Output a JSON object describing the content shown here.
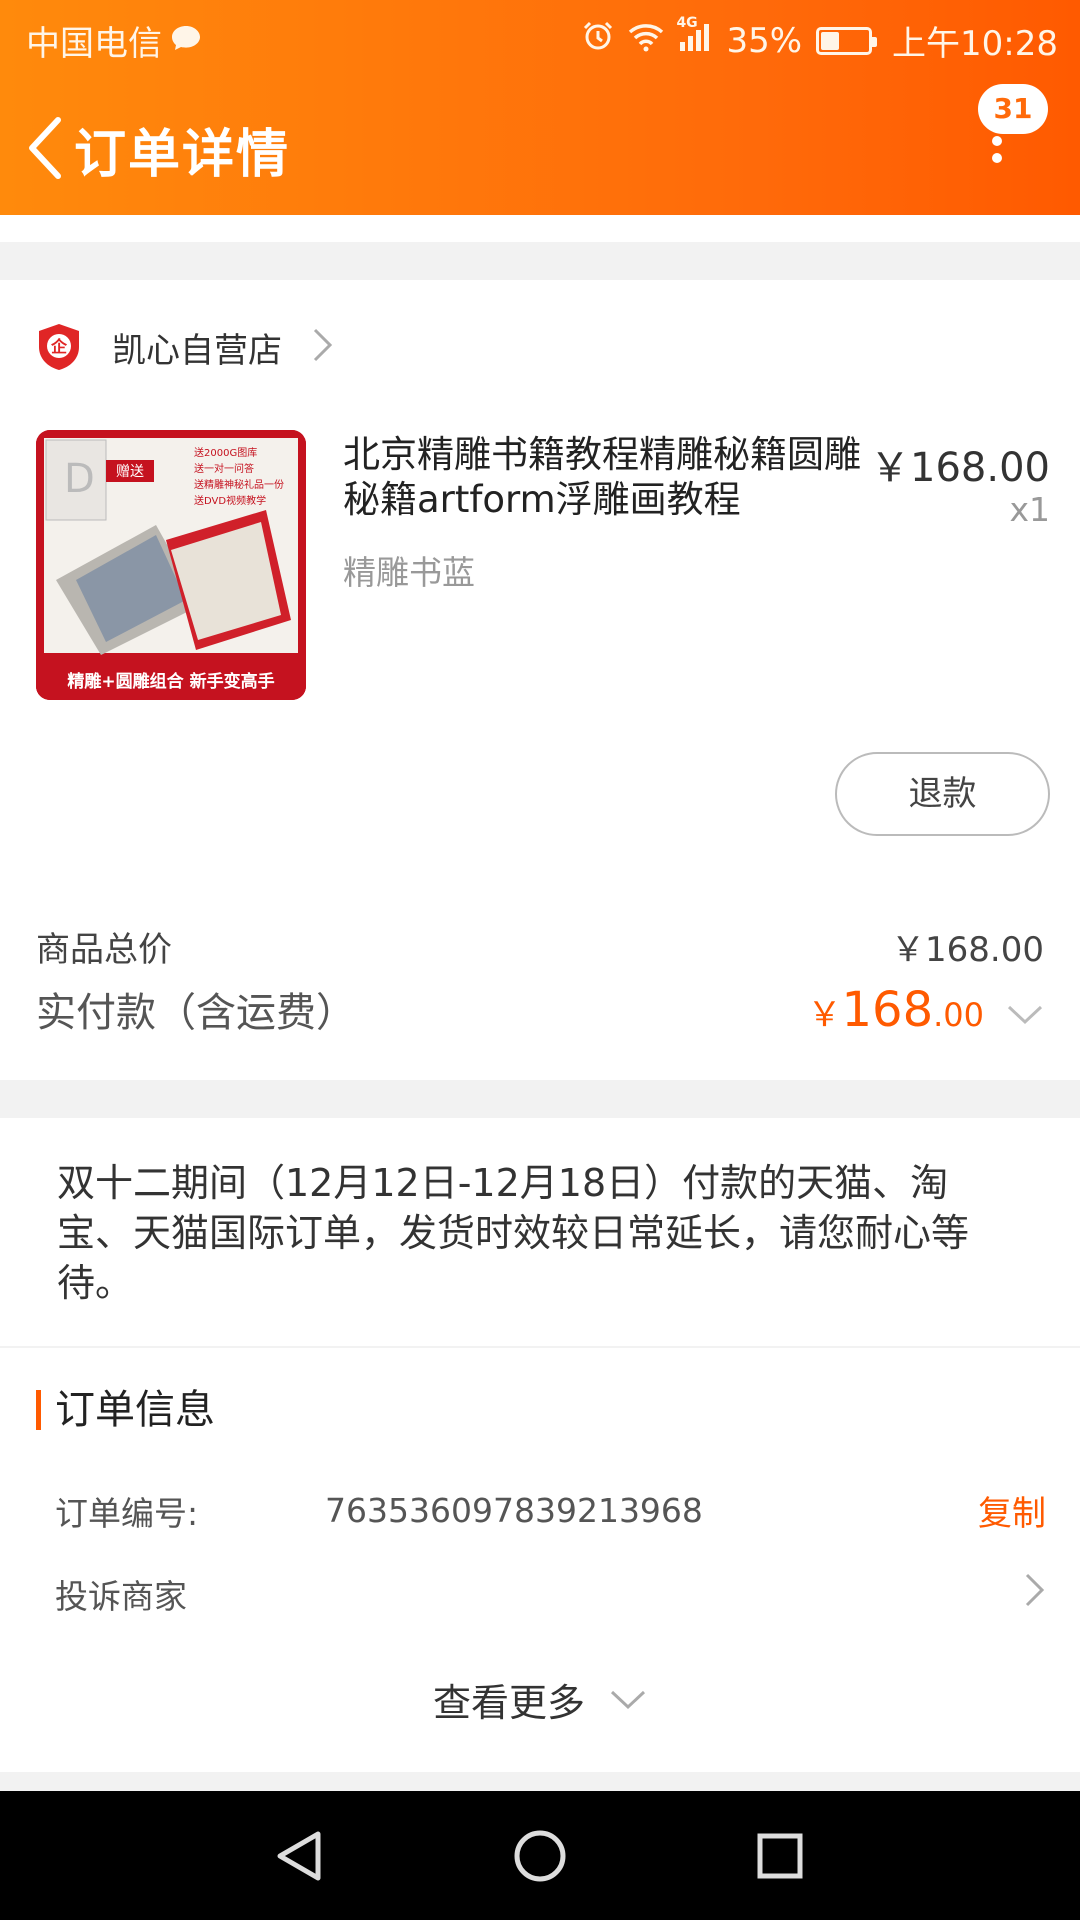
{
  "status_bar": {
    "carrier": "中国电信",
    "network": "4G",
    "battery_percent": "35%",
    "battery_level": 0.35,
    "time": "上午10:28",
    "icons": [
      "message-icon",
      "alarm-icon",
      "wifi-icon",
      "signal-icon",
      "battery-icon"
    ]
  },
  "nav": {
    "title": "订单详情",
    "badge_count": "31"
  },
  "shop": {
    "name": "凯心自营店"
  },
  "product": {
    "title": "北京精雕书籍教程精雕秘籍圆雕秘籍artform浮雕画教程",
    "sku": "精雕书蓝",
    "price": "￥168.00",
    "quantity": "x1",
    "image_texts": [
      "赠送",
      "送2000G图库",
      "送一对一问答",
      "送精雕神秘礼品一份",
      "送DVD视频教学",
      "精雕+圆雕组合 新手变高手"
    ]
  },
  "refund_label": "退款",
  "summary": {
    "goods_total_label": "商品总价",
    "goods_total_value": "￥168.00",
    "paid_label": "实付款（含运费）",
    "paid_currency": "￥",
    "paid_int": "168",
    "paid_dec": ".00"
  },
  "notice": "双十二期间（12月12日-12月18日）付款的天猫、淘宝、天猫国际订单，发货时效较日常延长，请您耐心等待。",
  "order_info": {
    "title": "订单信息",
    "order_no_label": "订单编号:",
    "order_no": "763536097839213968",
    "copy_label": "复制",
    "complaint_label": "投诉商家",
    "see_more_label": "查看更多"
  },
  "colors": {
    "accent": "#ff5a00",
    "header_start": "#ff8a0c",
    "header_end": "#ff5a00"
  }
}
